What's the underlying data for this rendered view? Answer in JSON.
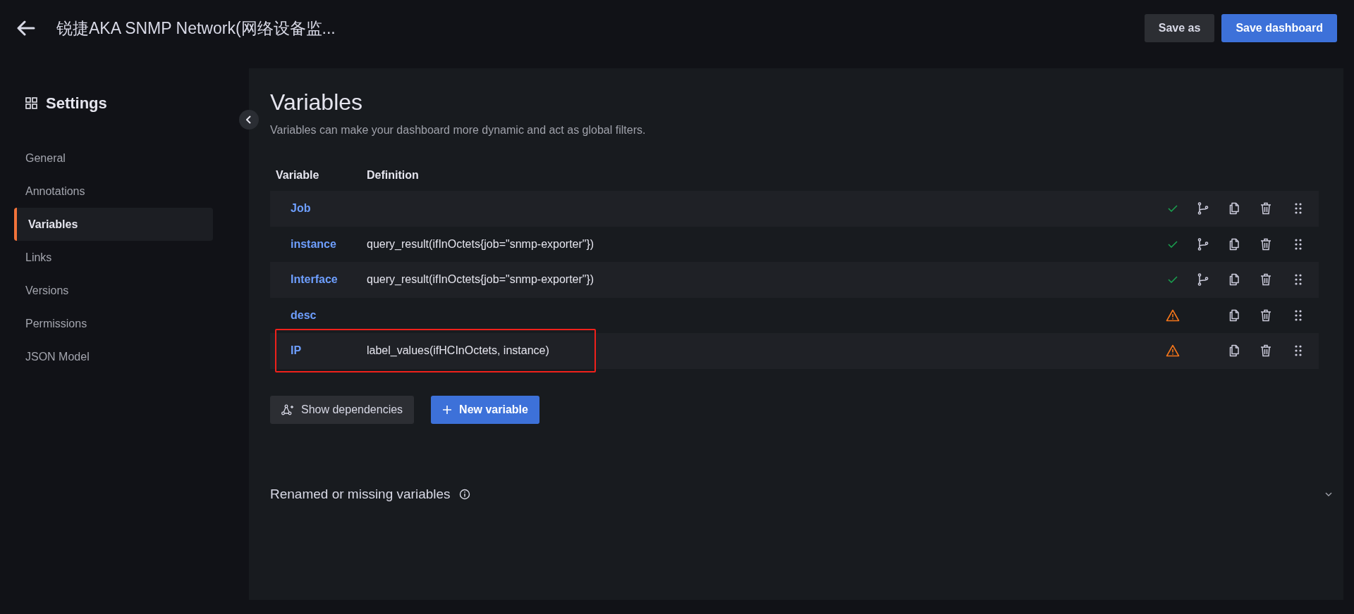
{
  "topbar": {
    "title": "锐捷AKA SNMP Network(网络设备监...",
    "buttons": [
      {
        "label": "Save as",
        "kind": "secondary"
      },
      {
        "label": "Save dashboard",
        "kind": "primary"
      }
    ]
  },
  "sidebar": {
    "title": "Settings",
    "items": [
      {
        "label": "General",
        "selected": false
      },
      {
        "label": "Annotations",
        "selected": false
      },
      {
        "label": "Variables",
        "selected": true
      },
      {
        "label": "Links",
        "selected": false
      },
      {
        "label": "Versions",
        "selected": false
      },
      {
        "label": "Permissions",
        "selected": false
      },
      {
        "label": "JSON Model",
        "selected": false
      }
    ]
  },
  "page": {
    "title": "Variables",
    "subtitle": "Variables can make your dashboard more dynamic and act as global filters.",
    "table": {
      "columns": [
        "Variable",
        "Definition"
      ],
      "rows": [
        {
          "name": "Job",
          "definition": "",
          "valid": true,
          "has_dependencies": true,
          "highlighted": false
        },
        {
          "name": "instance",
          "definition": "query_result(ifInOctets{job=\"snmp-exporter\"})",
          "valid": true,
          "has_dependencies": true,
          "highlighted": false
        },
        {
          "name": "Interface",
          "definition": "query_result(ifInOctets{job=\"snmp-exporter\"})",
          "valid": true,
          "has_dependencies": true,
          "highlighted": false
        },
        {
          "name": "desc",
          "definition": "",
          "valid": false,
          "has_dependencies": false,
          "highlighted": false
        },
        {
          "name": "IP",
          "definition": "label_values(ifHCInOctets, instance)",
          "valid": false,
          "has_dependencies": false,
          "highlighted": true
        }
      ]
    },
    "actions": [
      {
        "label": "Show dependencies",
        "kind": "secondary"
      },
      {
        "label": "New variable",
        "kind": "primary"
      }
    ],
    "renamed_section": {
      "title": "Renamed or missing variables",
      "expanded": false
    }
  }
}
